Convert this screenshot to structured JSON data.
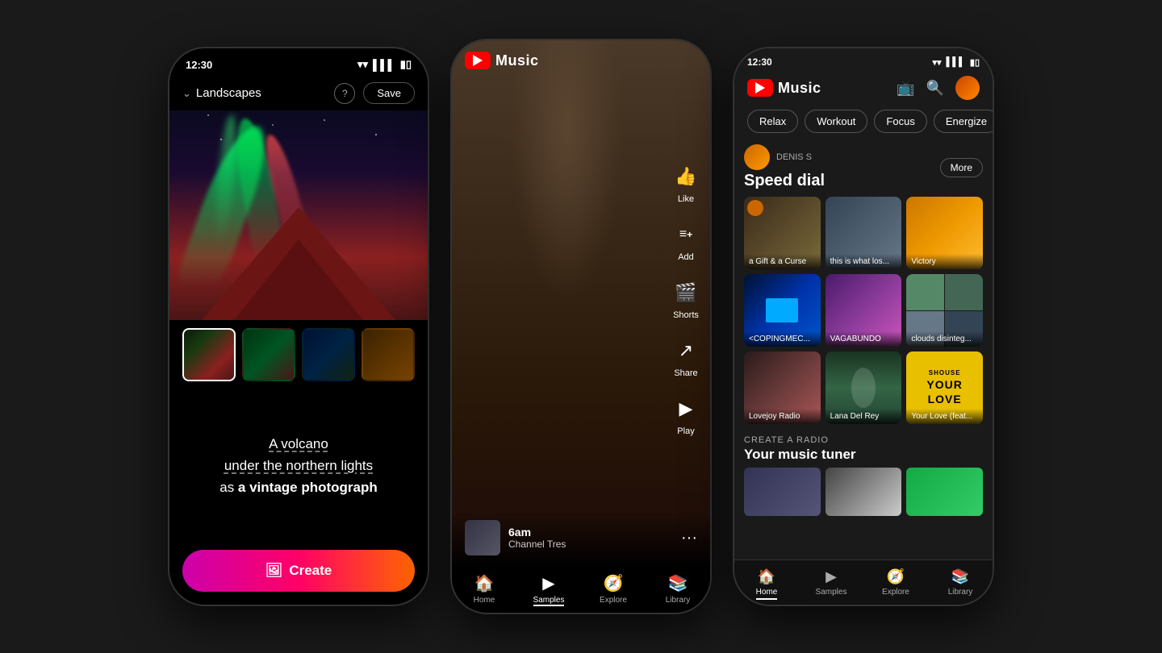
{
  "phone1": {
    "status_time": "12:30",
    "header_title": "Landscapes",
    "help_icon": "?",
    "save_label": "Save",
    "prompt_line1": "A volcano",
    "prompt_line2_pre": "",
    "prompt_line2_underline": "under the northern lights",
    "prompt_line3_pre": "as ",
    "prompt_line3_bold": "a vintage photograph",
    "create_label": "Create",
    "thumbnails": [
      {
        "id": 1,
        "active": true
      },
      {
        "id": 2,
        "active": false
      },
      {
        "id": 3,
        "active": false
      },
      {
        "id": 4,
        "active": false
      }
    ]
  },
  "phone2": {
    "app_name": "Music",
    "side_actions": [
      {
        "icon": "👍",
        "label": "Like"
      },
      {
        "icon": "≡+",
        "label": "Add"
      },
      {
        "icon": "🎬",
        "label": "Shorts"
      },
      {
        "icon": "↗",
        "label": "Share"
      },
      {
        "icon": "▶",
        "label": "Play"
      }
    ],
    "now_playing": {
      "title": "6am",
      "artist": "Channel Tres"
    },
    "nav_items": [
      {
        "icon": "🏠",
        "label": "Home",
        "active": false
      },
      {
        "icon": "▶",
        "label": "Samples",
        "active": true
      },
      {
        "icon": "🧭",
        "label": "Explore",
        "active": false
      },
      {
        "icon": "📚",
        "label": "Library",
        "active": false
      }
    ]
  },
  "phone3": {
    "status_time": "12:30",
    "app_name": "Music",
    "mood_tabs": [
      {
        "label": "Relax",
        "active": false
      },
      {
        "label": "Workout",
        "active": false
      },
      {
        "label": "Focus",
        "active": false
      },
      {
        "label": "Energize",
        "active": false
      }
    ],
    "user_name": "DENIS S",
    "section_title": "Speed dial",
    "more_label": "More",
    "cards": [
      {
        "label": "a Gift & a Curse",
        "bg": 1
      },
      {
        "label": "this is what los...",
        "bg": 2
      },
      {
        "label": "Victory",
        "bg": 3
      },
      {
        "label": "<COPINGMEC...",
        "bg": 4
      },
      {
        "label": "VAGABUNDO",
        "bg": 5
      },
      {
        "label": "clouds disinteg...",
        "bg": 6
      },
      {
        "label": "Lovejoy Radio",
        "bg": 7
      },
      {
        "label": "Lana Del Rey",
        "bg": 8
      },
      {
        "label": "Your Love (feat...",
        "bg": 9
      }
    ],
    "radio_label": "CREATE A RADIO",
    "radio_title": "Your music tuner",
    "nav_items": [
      {
        "icon": "🏠",
        "label": "Home",
        "active": true
      },
      {
        "icon": "▶",
        "label": "Samples",
        "active": false
      },
      {
        "icon": "🧭",
        "label": "Explore",
        "active": false
      },
      {
        "icon": "📚",
        "label": "Library",
        "active": false
      }
    ]
  }
}
